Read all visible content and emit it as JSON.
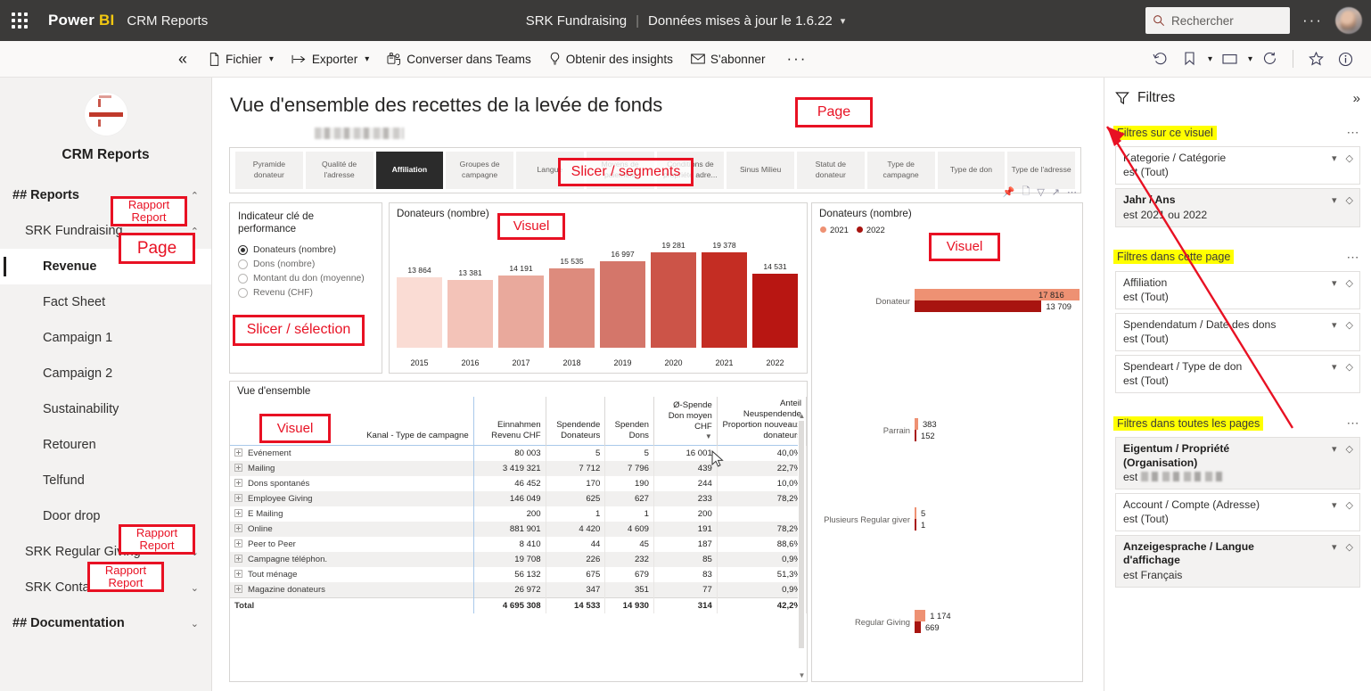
{
  "topbar": {
    "brand_power": "Power",
    "brand_bi": "BI",
    "workspace": "CRM Reports",
    "report_name": "SRK Fundraising",
    "separator": "|",
    "refresh_text": "Données mises à jour le 1.6.22",
    "caret": "⌄",
    "search_placeholder": "Rechercher",
    "more_label": "···",
    "waffle_name": "app-launcher"
  },
  "ribbon": {
    "collapse": "«",
    "items": [
      {
        "icon": "file-icon",
        "label": "Fichier",
        "has_caret": true
      },
      {
        "icon": "export-icon",
        "label": "Exporter",
        "has_caret": true
      },
      {
        "icon": "teams-icon",
        "label": "Converser dans Teams",
        "has_caret": false
      },
      {
        "icon": "bulb-icon",
        "label": "Obtenir des insights",
        "has_caret": false
      },
      {
        "icon": "mail-icon",
        "label": "S'abonner",
        "has_caret": false
      }
    ],
    "overflow": "···",
    "right_icons": [
      "reset-icon",
      "bookmark-icon",
      "view-icon",
      "refresh-icon",
      "favorite-icon",
      "info-icon"
    ]
  },
  "sidebar": {
    "logo_name": "crm-reports-logo",
    "title": "CRM Reports",
    "sections": [
      {
        "label": "## Reports",
        "chevron": "⌃",
        "type": "section"
      },
      {
        "label": "SRK Fundraising",
        "chevron": "⌃",
        "type": "report",
        "annotation": "Rapport\nReport"
      },
      {
        "label": "Revenue",
        "type": "page",
        "active": true,
        "annotation": "Page"
      },
      {
        "label": "Fact Sheet",
        "type": "page"
      },
      {
        "label": "Campaign 1",
        "type": "page"
      },
      {
        "label": "Campaign 2",
        "type": "page"
      },
      {
        "label": "Sustainability",
        "type": "page"
      },
      {
        "label": "Retouren",
        "type": "page"
      },
      {
        "label": "Telfund",
        "type": "page"
      },
      {
        "label": "Door drop",
        "type": "page"
      },
      {
        "label": "SRK Regular Giving",
        "chevron": "⌄",
        "type": "report",
        "annotation": "Rapport\nReport"
      },
      {
        "label": "SRK Contacts",
        "chevron": "⌄",
        "type": "report",
        "annotation": "Rapport\nReport"
      },
      {
        "label": "## Documentation",
        "chevron": "⌄",
        "type": "section"
      }
    ]
  },
  "annotations": {
    "page_top": "Page",
    "page_nav": "Page",
    "report1": "Rapport\nReport",
    "report2": "Rapport\nReport",
    "report3": "Rapport\nReport",
    "slicer_segments": "Slicer / segments",
    "slicer_selection": "Slicer / sélection",
    "visual_bar": "Visuel",
    "visual_hbar": "Visuel",
    "visual_table": "Visuel",
    "hl_visual_filters": "Filtres sur ce visuel",
    "hl_page_filters": "Filtres dans cette page",
    "hl_all_filters": "Filtres dans toutes les pages"
  },
  "report": {
    "title": "Vue d'ensemble des recettes de la levée de fonds",
    "subtitle_redacted": true,
    "slicer_tabs": [
      {
        "label": "Pyramide donateur",
        "selected": false
      },
      {
        "label": "Qualité de l'adresse",
        "selected": false
      },
      {
        "label": "Affiliation",
        "selected": true
      },
      {
        "label": "Groupes de campagne",
        "selected": false
      },
      {
        "label": "Langue",
        "selected": false
      },
      {
        "label": "Moyens de paiement",
        "selected": false
      },
      {
        "label": "Conditions de propriété adre...",
        "selected": false
      },
      {
        "label": "Sinus Milieu",
        "selected": false
      },
      {
        "label": "Statut de donateur",
        "selected": false
      },
      {
        "label": "Type de campagne",
        "selected": false
      },
      {
        "label": "Type de don",
        "selected": false
      },
      {
        "label": "Type de l'adresse",
        "selected": false
      }
    ],
    "kpi_slicer": {
      "title": "Indicateur clé de performance",
      "options": [
        {
          "label": "Donateurs (nombre)",
          "selected": true
        },
        {
          "label": "Dons (nombre)",
          "selected": false
        },
        {
          "label": "Montant du don (moyenne)",
          "selected": false
        },
        {
          "label": "Revenu (CHF)",
          "selected": false
        }
      ]
    },
    "visual_header_icons": [
      "pin-icon",
      "copy-icon",
      "filter-icon",
      "focus-icon",
      "more-icon"
    ]
  },
  "chart_data": [
    {
      "type": "bar",
      "id": "donors-by-year",
      "title": "Donateurs (nombre)",
      "xlabel": "",
      "ylabel": "",
      "categories": [
        "2015",
        "2016",
        "2017",
        "2018",
        "2019",
        "2020",
        "2021",
        "2022"
      ],
      "values": [
        13864,
        13381,
        14191,
        15535,
        16997,
        19281,
        19378,
        14531
      ],
      "value_labels": [
        "13 864",
        "13 381",
        "14 191",
        "15 535",
        "16 997",
        "19 281",
        "19 378",
        "14 531"
      ],
      "colors": [
        "#fadcd4",
        "#f3c3b8",
        "#e9a99c",
        "#dd8b7d",
        "#d4766a",
        "#cc5448",
        "#c42d23",
        "#b81612"
      ],
      "ylim": [
        0,
        21000
      ],
      "grid": false,
      "legend": "none"
    },
    {
      "type": "bar",
      "id": "donors-by-affiliation",
      "orientation": "horizontal",
      "title": "Donateurs (nombre)",
      "legend": [
        "2021",
        "2022"
      ],
      "legend_colors": [
        "#ee9173",
        "#a81410"
      ],
      "legend_position": "top-left",
      "categories": [
        "Donateur",
        "Parrain",
        "Plusieurs Regular giver",
        "Regular Giving"
      ],
      "series": [
        {
          "name": "2021",
          "values": [
            17816,
            383,
            5,
            1174
          ],
          "labels": [
            "17 816",
            "383",
            "5",
            "1 174"
          ]
        },
        {
          "name": "2022",
          "values": [
            13709,
            152,
            1,
            669
          ],
          "labels": [
            "13 709",
            "152",
            "1",
            "669"
          ]
        }
      ],
      "xlim": [
        0,
        17816
      ]
    }
  ],
  "table": {
    "title": "Vue d'ensemble",
    "columns": [
      {
        "line1": "Kanal - Type de campagne",
        "line2": "",
        "line3": ""
      },
      {
        "line1": "Einnahmen",
        "line2": "Revenu CHF",
        "line3": ""
      },
      {
        "line1": "Spendende",
        "line2": "Donateurs",
        "line3": ""
      },
      {
        "line1": "Spenden",
        "line2": "Dons",
        "line3": ""
      },
      {
        "line1": "Ø-Spende",
        "line2": "Don moyen",
        "line3": "CHF",
        "sorted": true
      },
      {
        "line1": "Anteil Neuspendende",
        "line2": "Proportion nouveaux",
        "line3": "donateurs"
      }
    ],
    "rows": [
      {
        "c0": "Evénement",
        "c1": "80 003",
        "c2": "5",
        "c3": "5",
        "c4": "16 001",
        "c5": "40,0%"
      },
      {
        "c0": "Mailing",
        "c1": "3 419 321",
        "c2": "7 712",
        "c3": "7 796",
        "c4": "439",
        "c5": "22,7%"
      },
      {
        "c0": "Dons spontanés",
        "c1": "46 452",
        "c2": "170",
        "c3": "190",
        "c4": "244",
        "c5": "10,0%"
      },
      {
        "c0": "Employee Giving",
        "c1": "146 049",
        "c2": "625",
        "c3": "627",
        "c4": "233",
        "c5": "78,2%"
      },
      {
        "c0": "E Mailing",
        "c1": "200",
        "c2": "1",
        "c3": "1",
        "c4": "200",
        "c5": ""
      },
      {
        "c0": "Online",
        "c1": "881 901",
        "c2": "4 420",
        "c3": "4 609",
        "c4": "191",
        "c5": "78,2%"
      },
      {
        "c0": "Peer to Peer",
        "c1": "8 410",
        "c2": "44",
        "c3": "45",
        "c4": "187",
        "c5": "88,6%"
      },
      {
        "c0": "Campagne téléphon.",
        "c1": "19 708",
        "c2": "226",
        "c3": "232",
        "c4": "85",
        "c5": "0,9%"
      },
      {
        "c0": "Tout ménage",
        "c1": "56 132",
        "c2": "675",
        "c3": "679",
        "c4": "83",
        "c5": "51,3%"
      },
      {
        "c0": "Magazine donateurs",
        "c1": "26 972",
        "c2": "347",
        "c3": "351",
        "c4": "77",
        "c5": "0,9%"
      }
    ],
    "total": {
      "c0": "Total",
      "c1": "4 695 308",
      "c2": "14 533",
      "c3": "14 930",
      "c4": "314",
      "c5": "42,2%"
    }
  },
  "filters": {
    "header": "Filtres",
    "expand_icon": "»",
    "groups": [
      {
        "label": "Filtres sur ce visuel",
        "highlight": true,
        "items": [
          {
            "name": "Kategorie / Catégorie",
            "value": "est (Tout)",
            "bold": false,
            "shaded": false
          },
          {
            "name": "Jahr / Ans",
            "value": "est 2021 ou 2022",
            "bold": true,
            "shaded": true
          }
        ]
      },
      {
        "label": "Filtres dans cette page",
        "highlight": true,
        "items": [
          {
            "name": "Affiliation",
            "value": "est (Tout)",
            "bold": false,
            "shaded": false
          },
          {
            "name": "Spendendatum / Date des dons",
            "value": "est (Tout)",
            "bold": false,
            "shaded": false
          },
          {
            "name": "Spendeart / Type de don",
            "value": "est (Tout)",
            "bold": false,
            "shaded": false
          }
        ]
      },
      {
        "label": "Filtres dans toutes les pages",
        "highlight": true,
        "items": [
          {
            "name": "Eigentum / Propriété (Organisation)",
            "value": "est ",
            "value_redacted": true,
            "bold": true,
            "shaded": true
          },
          {
            "name": "Account / Compte (Adresse)",
            "value": "est (Tout)",
            "bold": false,
            "shaded": false
          },
          {
            "name": "Anzeigesprache / Langue d'affichage",
            "value": "est Français",
            "bold": true,
            "shaded": true
          }
        ]
      }
    ]
  }
}
